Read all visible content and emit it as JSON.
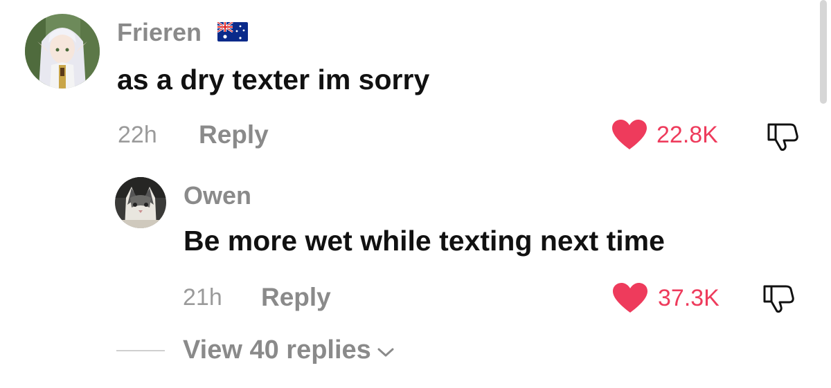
{
  "comment": {
    "username": "Frieren",
    "flag_icon": "australia-flag-icon",
    "text": "as a dry texter im sorry",
    "time": "22h",
    "reply_label": "Reply",
    "likes": "22.8K"
  },
  "reply": {
    "username": "Owen",
    "text": "Be more wet while texting next time",
    "time": "21h",
    "reply_label": "Reply",
    "likes": "37.3K"
  },
  "view_replies_label": "View 40 replies",
  "colors": {
    "like_accent": "#ee3b5c",
    "muted_text": "#8a8a8a"
  }
}
